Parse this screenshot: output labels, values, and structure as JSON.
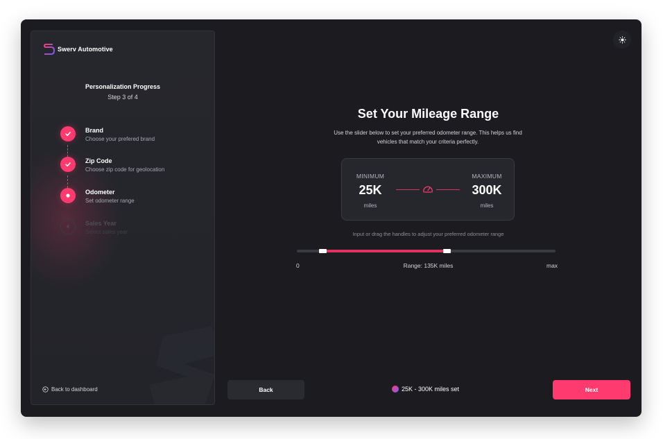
{
  "brand": {
    "name": "Swerv Automotive",
    "logo_icon": "swerv-logo-icon"
  },
  "sidebar": {
    "progress_title": "Personalization Progress",
    "progress_step": "Step 3 of 4",
    "steps": [
      {
        "title": "Brand",
        "subtitle": "Choose your prefered brand",
        "state": "done",
        "icon": "check-icon"
      },
      {
        "title": "Zip Code",
        "subtitle": "Choose zip code for geolocation",
        "state": "done",
        "icon": "check-icon"
      },
      {
        "title": "Odometer",
        "subtitle": "Set odometer range",
        "state": "active",
        "icon": "dot-icon"
      },
      {
        "title": "Sales Year",
        "subtitle": "Select sales year",
        "state": "pending",
        "number": "4"
      }
    ],
    "back_label": "Back to dashboard"
  },
  "main": {
    "title": "Set Your Mileage Range",
    "description": "Use the slider below to set your preferred odometer range. This helps us find vehicles that match your criteria perfectly.",
    "range_card": {
      "min_label": "MINIMUM",
      "min_value": "25K",
      "min_unit": "miles",
      "max_label": "MAXIMUM",
      "max_value": "300K",
      "max_unit": "miles",
      "icon": "speedometer-icon"
    },
    "hint": "Input or drag the handles to adjust your preferred odometer range",
    "slider": {
      "axis_min": "0",
      "axis_max": "max",
      "range_text": "Range: 135K miles",
      "lower_fraction": 0.1,
      "upper_fraction": 0.58
    }
  },
  "footer": {
    "back_label": "Back",
    "status_text": "25K - 300K miles set",
    "next_label": "Next"
  },
  "colors": {
    "accent": "#ff3a6e",
    "background": "#1b1b20",
    "panel": "#26272d"
  },
  "theme_toggle_icon": "sun-icon"
}
